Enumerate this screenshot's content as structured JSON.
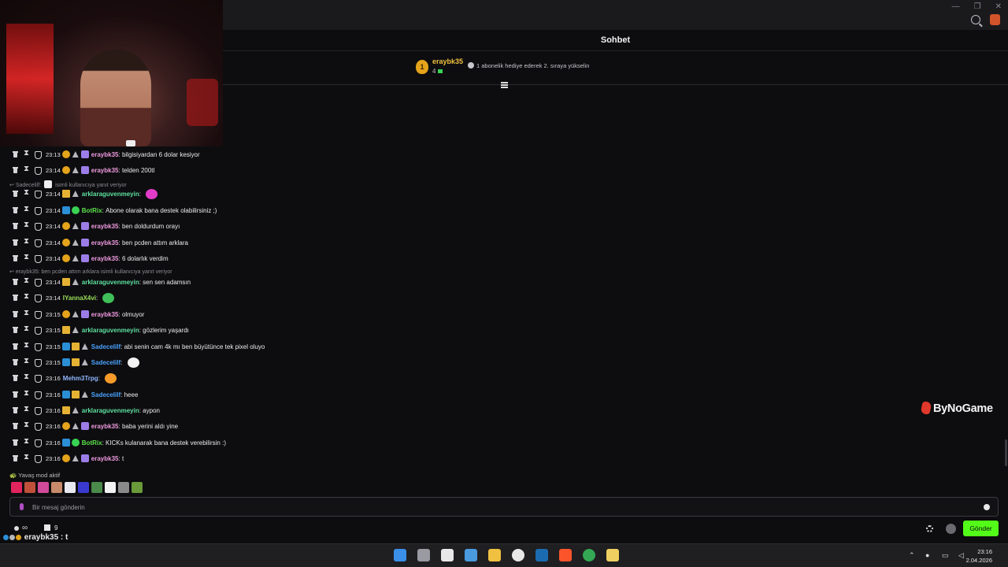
{
  "window": {
    "controls": [
      "—",
      "❐",
      "✕"
    ]
  },
  "chat": {
    "title": "Sohbet",
    "pinned": {
      "badge": "1",
      "user": "eraybk35",
      "count": "4",
      "message": "1 abonelik hediye ederek 2. sıraya yükselin"
    },
    "messages": [
      {
        "time": "23:13",
        "badges": [
          "sub",
          "mod",
          "gift"
        ],
        "user": "eraybk35",
        "user_color": "#f09ae0",
        "text": "bilgisiyardan 6 dolar kesiyor"
      },
      {
        "time": "23:14",
        "badges": [
          "sub",
          "mod",
          "gift"
        ],
        "user": "eraybk35",
        "user_color": "#f09ae0",
        "text": "telden 200tl"
      },
      {
        "time": "23:14",
        "badges": [
          "vip",
          "mod"
        ],
        "user": "arklaraguvenmeyin",
        "user_color": "#5ee0a0",
        "text": "",
        "emote": "#e33cc9"
      },
      {
        "time": "23:14",
        "badges": [
          "og",
          "bot"
        ],
        "user": "BotRix",
        "user_color": "#5be34b",
        "text": "Abone olarak bana destek olabilirsiniz ;)"
      },
      {
        "time": "23:14",
        "badges": [
          "sub",
          "mod",
          "gift"
        ],
        "user": "eraybk35",
        "user_color": "#f09ae0",
        "text": "ben doldurdum orayı"
      },
      {
        "time": "23:14",
        "badges": [
          "sub",
          "mod",
          "gift"
        ],
        "user": "eraybk35",
        "user_color": "#f09ae0",
        "text": "ben pcden attım arklara"
      },
      {
        "time": "23:14",
        "badges": [
          "sub",
          "mod",
          "gift"
        ],
        "user": "eraybk35",
        "user_color": "#f09ae0",
        "text": "6 dolarlık verdim"
      },
      {
        "time": "23:14",
        "badges": [
          "vip",
          "mod"
        ],
        "user": "arklaraguvenmeyin",
        "user_color": "#5ee0a0",
        "text": "sen sen adamsın"
      },
      {
        "time": "23:14",
        "badges": [],
        "user": "IYannaX4vi",
        "user_color": "#9be05a",
        "text": "",
        "emote": "#3fbf5a"
      },
      {
        "time": "23:15",
        "badges": [
          "sub",
          "mod",
          "gift"
        ],
        "user": "eraybk35",
        "user_color": "#f09ae0",
        "text": "olmuyor"
      },
      {
        "time": "23:15",
        "badges": [
          "vip",
          "mod"
        ],
        "user": "arklaraguvenmeyin",
        "user_color": "#5ee0a0",
        "text": "gözlerim yaşardı"
      },
      {
        "time": "23:15",
        "badges": [
          "og",
          "vip",
          "mod"
        ],
        "user": "Sadecelilf",
        "user_color": "#4aa3ff",
        "text": "abi senin cam 4k mı ben büyütünce tek pixel oluyo"
      },
      {
        "time": "23:15",
        "badges": [
          "og",
          "vip",
          "mod"
        ],
        "user": "Sadecelilf",
        "user_color": "#4aa3ff",
        "text": "",
        "emote": "#f2f2f2"
      },
      {
        "time": "23:16",
        "badges": [],
        "user": "Mehm3Trpg",
        "user_color": "#8fb7ff",
        "text": "",
        "emote": "#f59a2a"
      },
      {
        "time": "23:16",
        "badges": [
          "og",
          "vip",
          "mod"
        ],
        "user": "Sadecelilf",
        "user_color": "#4aa3ff",
        "text": "heee"
      },
      {
        "time": "23:16",
        "badges": [
          "vip",
          "mod"
        ],
        "user": "arklaraguvenmeyin",
        "user_color": "#5ee0a0",
        "text": "aypon"
      },
      {
        "time": "23:16",
        "badges": [
          "sub",
          "mod",
          "gift"
        ],
        "user": "eraybk35",
        "user_color": "#f09ae0",
        "text": "baba yerini aldı yine"
      },
      {
        "time": "23:16",
        "badges": [
          "og",
          "bot"
        ],
        "user": "BotRix",
        "user_color": "#5be34b",
        "text": "KICKs kulanarak bana destek verebilirsin :)"
      },
      {
        "time": "23:16",
        "badges": [
          "sub",
          "mod",
          "gift"
        ],
        "user": "eraybk35",
        "user_color": "#f09ae0",
        "text": "t"
      }
    ],
    "replies": [
      {
        "user": "Sadecelilf:",
        "text": "isimli kullanıcıya yanıt veriyor"
      },
      {
        "user": "",
        "text": "eraybk35: ben pcden attım arklara isimli kullanıcıya yanıt veriyor"
      }
    ],
    "slow_mode": "Yavaş mod aktif",
    "emote_colors": [
      "#e0245e",
      "#c0503a",
      "#d04a9a",
      "#c78a6a",
      "#e8e8f0",
      "#3a3ad0",
      "#4a8a4a",
      "#f2f2f2",
      "#8a8a8a",
      "#6a9a3a"
    ],
    "input": {
      "placeholder": "Bir mesaj gönderin"
    },
    "viewers": "∞",
    "subs_count": "9",
    "last_message": "eraybk35 : t",
    "send_label": "Gönder"
  },
  "overlay": {
    "logo": "ByNoGame"
  },
  "taskbar": {
    "icons": [
      "windows",
      "task-view",
      "app",
      "photos",
      "files",
      "obs",
      "steam",
      "brave",
      "chrome",
      "media"
    ],
    "icon_colors": [
      "#3a8fe8",
      "#9a9aa2",
      "#e8e8e8",
      "#4a9ae0",
      "#f0c040",
      "#e8e8e8",
      "#1b6bb0",
      "#fb542b",
      "#34a853",
      "#f0d060"
    ],
    "time": "23:16",
    "date": "2.04.2026"
  }
}
